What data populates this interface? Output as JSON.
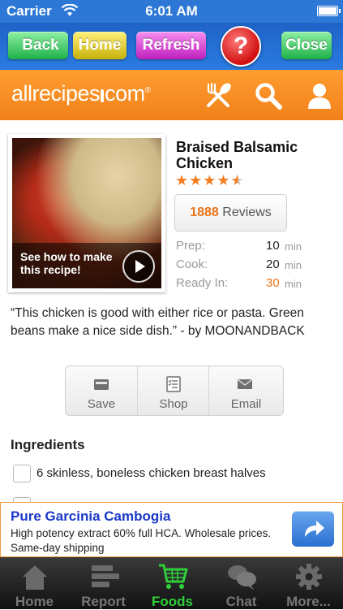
{
  "status": {
    "carrier": "Carrier",
    "time": "6:01 AM"
  },
  "nav": {
    "back": "Back",
    "home": "Home",
    "refresh": "Refresh",
    "help": "?",
    "close": "Close"
  },
  "brand": {
    "name_left": "allrecipes",
    "name_right": "com",
    "reg": "®"
  },
  "recipe": {
    "title": "Braised Balsamic Chicken",
    "rating": 4.5,
    "stars_full": "★★★★",
    "stars_half": "★",
    "reviews_count": "1888",
    "reviews_label": "Reviews",
    "video_caption": "See how to make this recipe!",
    "prep_label": "Prep:",
    "prep_value": "10",
    "prep_unit": "min",
    "cook_label": "Cook:",
    "cook_value": "20",
    "cook_unit": "min",
    "ready_label": "Ready In:",
    "ready_value": "30",
    "ready_unit": "min",
    "quote": "“This chicken is good with either rice or pasta. Green beans make a nice side dish.” - by MOONANDBACK"
  },
  "actions": {
    "save": "Save",
    "shop": "Shop",
    "email": "Email"
  },
  "ingredients": {
    "heading": "Ingredients",
    "items": [
      "6 skinless, boneless chicken breast halves"
    ]
  },
  "ad": {
    "headline": "Pure Garcinia Cambogia",
    "text": "High potency extract 60% full HCA. Wholesale prices. Same-day shipping"
  },
  "tabs": {
    "home": "Home",
    "report": "Report",
    "foods": "Foods",
    "chat": "Chat",
    "more": "More..."
  },
  "colors": {
    "accent_orange": "#f1811a",
    "nav_blue": "#2a7be0",
    "active_tab": "#2fcf3a",
    "ad_link": "#1a37c8"
  }
}
